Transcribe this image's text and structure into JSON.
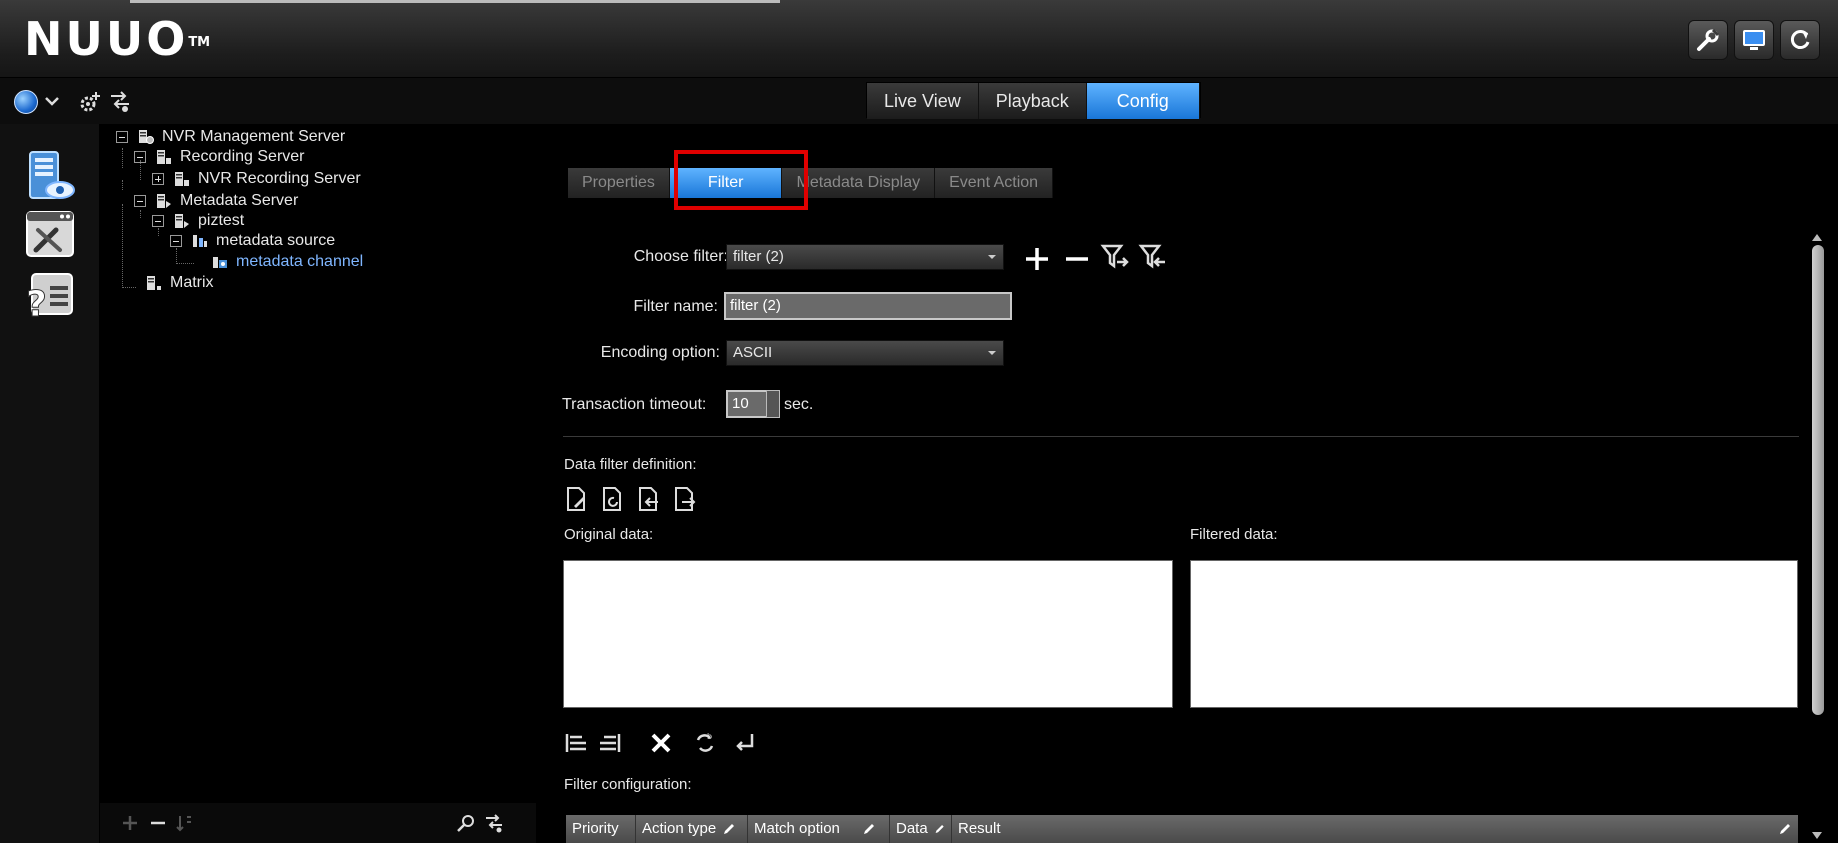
{
  "app": {
    "logo": "NUUO",
    "trademark": "TM"
  },
  "header_buttons": [
    {
      "icon": "wrench-icon"
    },
    {
      "icon": "monitor-icon"
    },
    {
      "icon": "refresh-icon"
    }
  ],
  "mode_tabs": [
    {
      "label": "Live View",
      "active": false
    },
    {
      "label": "Playback",
      "active": false
    },
    {
      "label": "Config",
      "active": true
    }
  ],
  "tree": {
    "items": [
      {
        "label": "NVR Management Server",
        "expander": "minus"
      },
      {
        "label": "Recording Server",
        "expander": "minus"
      },
      {
        "label": "NVR Recording Server",
        "expander": "plus"
      },
      {
        "label": "Metadata Server",
        "expander": "minus"
      },
      {
        "label": "piztest",
        "expander": "minus"
      },
      {
        "label": "metadata source",
        "expander": "minus"
      },
      {
        "label": "metadata channel",
        "expander": "none",
        "selected": true
      },
      {
        "label": "Matrix",
        "expander": "none"
      }
    ]
  },
  "sub_tabs": [
    {
      "label": "Properties",
      "active": false
    },
    {
      "label": "Filter",
      "active": true
    },
    {
      "label": "Metadata Display",
      "active": false
    },
    {
      "label": "Event Action",
      "active": false
    }
  ],
  "form": {
    "choose_filter_label": "Choose filter:",
    "choose_filter_value": "filter (2)",
    "filter_name_label": "Filter name:",
    "filter_name_value": "filter (2)",
    "encoding_label": "Encoding option:",
    "encoding_value": "ASCII",
    "timeout_label": "Transaction timeout:",
    "timeout_value": "10",
    "timeout_unit": "sec."
  },
  "sections": {
    "data_filter_definition": "Data filter definition:",
    "original_data": "Original data:",
    "filtered_data": "Filtered data:",
    "filter_configuration": "Filter configuration:"
  },
  "config_columns": [
    {
      "label": "Priority",
      "editable": false
    },
    {
      "label": "Action type",
      "editable": true
    },
    {
      "label": "Match option",
      "editable": true
    },
    {
      "label": "Data",
      "editable": true
    },
    {
      "label": "Result",
      "editable": true
    }
  ],
  "colors": {
    "accent": "#1976d8",
    "highlight_frame": "#e00000",
    "selected_tree_text": "#7fb6ff"
  }
}
